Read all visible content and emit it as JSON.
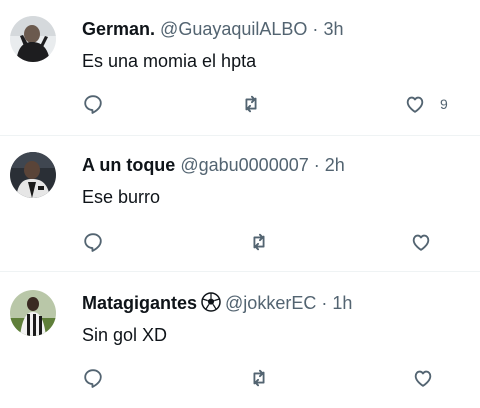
{
  "replies": [
    {
      "name": "German.",
      "handle": "@GuayaquilALBO",
      "separator": "·",
      "time": "3h",
      "text": "Es una momia el hpta",
      "like_count": "9"
    },
    {
      "name": "A un toque",
      "handle": "@gabu0000007",
      "separator": "·",
      "time": "2h",
      "text": "Ese burro",
      "like_count": ""
    },
    {
      "name": "Matagigantes",
      "name_emoji": "soccer-ball-icon",
      "handle": "@jokkerEC",
      "separator": "·",
      "time": "1h",
      "text": "Sin gol XD",
      "like_count": ""
    }
  ],
  "icons": {
    "reply": "reply-icon",
    "retweet": "retweet-icon",
    "like": "like-icon"
  },
  "colors": {
    "text": "#0f1419",
    "secondary": "#536471",
    "divider": "#eff3f4"
  }
}
